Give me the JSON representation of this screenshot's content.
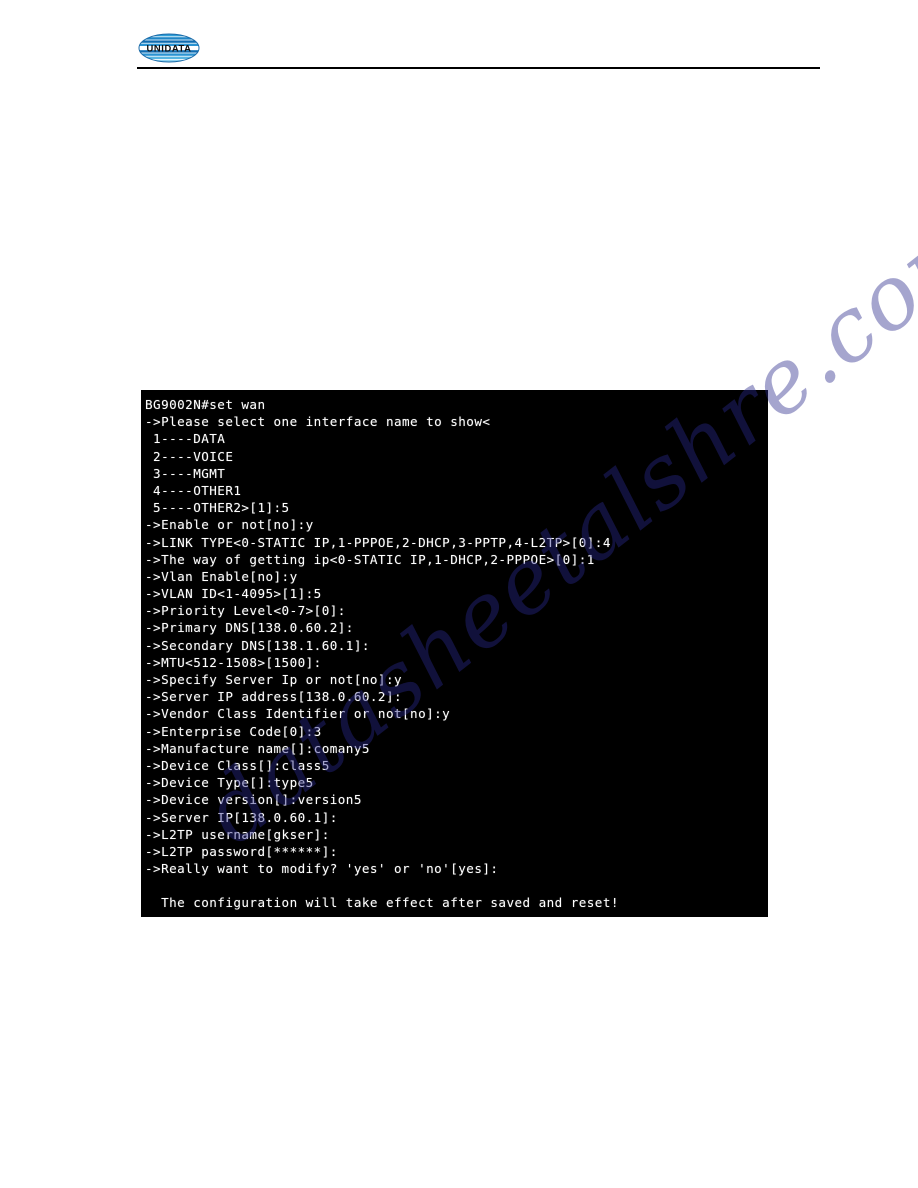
{
  "page": {
    "background_color": "#ffffff",
    "header": {
      "logo_text": "UNIDATA",
      "logo_colors": {
        "dark_blue": "#0b5fa5",
        "mid_blue": "#1d8fd1",
        "light_blue": "#8fd3ef",
        "outline": "#1a6aa8"
      },
      "rule_color": "#000000"
    },
    "watermark": {
      "text": "datasheetalshre.com",
      "color": "#2a2a8c",
      "rotation_degrees": -38
    }
  },
  "terminal": {
    "background_color": "#000000",
    "text_color": "#ffffff",
    "prompt_host": "BG9002N",
    "command": "set wan",
    "lines": [
      "BG9002N#set wan",
      "->Please select one interface name to show<",
      " 1----DATA",
      " 2----VOICE",
      " 3----MGMT",
      " 4----OTHER1",
      " 5----OTHER2>[1]:5",
      "->Enable or not[no]:y",
      "->LINK TYPE<0-STATIC IP,1-PPPOE,2-DHCP,3-PPTP,4-L2TP>[0]:4",
      "->The way of getting ip<0-STATIC IP,1-DHCP,2-PPPOE>[0]:1",
      "->Vlan Enable[no]:y",
      "->VLAN ID<1-4095>[1]:5",
      "->Priority Level<0-7>[0]:",
      "->Primary DNS[138.0.60.2]:",
      "->Secondary DNS[138.1.60.1]:",
      "->MTU<512-1508>[1500]:",
      "->Specify Server Ip or not[no]:y",
      "->Server IP address[138.0.60.2]:",
      "->Vendor Class Identifier or not[no]:y",
      "->Enterprise Code[0]:3",
      "->Manufacture name[]:comany5",
      "->Device Class[]:class5",
      "->Device Type[]:type5",
      "->Device version[]:version5",
      "->Server IP[138.0.60.1]:",
      "->L2TP username[gkser]:",
      "->L2TP password[******]:",
      "->Really want to modify? 'yes' or 'no'[yes]:",
      "",
      "  The configuration will take effect after saved and reset!"
    ]
  }
}
